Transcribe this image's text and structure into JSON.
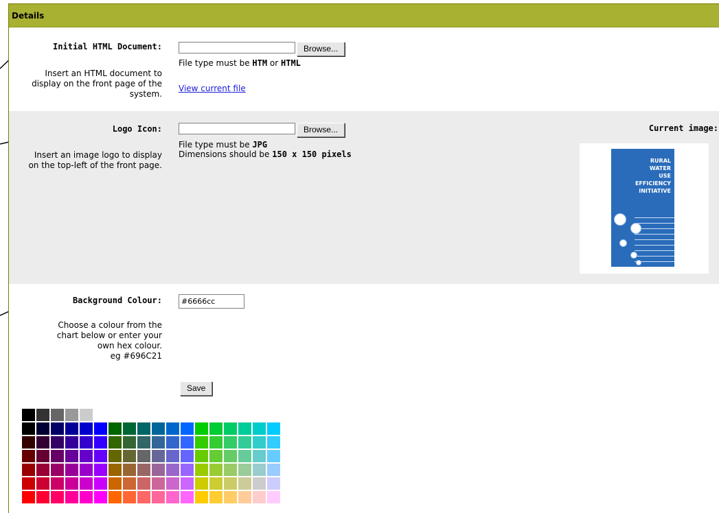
{
  "header": {
    "title": "Details"
  },
  "initial_html": {
    "label": "Initial HTML Document:",
    "description": "Insert an HTML document to display on the front page of the system.",
    "browse": "Browse...",
    "note_prefix": "File type must be ",
    "note_htm": "HTM",
    "note_or": " or ",
    "note_html": "HTML",
    "link": "View current file"
  },
  "logo_icon": {
    "label": "Logo Icon:",
    "description": "Insert an image logo to display on the top-left of the front page.",
    "browse": "Browse...",
    "note1_prefix": "File type must be ",
    "note1_type": "JPG",
    "note2_prefix": "Dimensions should be ",
    "note2_dims": "150 x 150 pixels",
    "current_label": "Current image:",
    "logo_lines": [
      "RURAL",
      "WATER",
      "USE",
      "EFFICIENCY",
      "INITIATIVE"
    ]
  },
  "background": {
    "label": "Background Colour:",
    "description_lines": [
      "Choose a colour from the",
      "chart below or enter your",
      "own hex colour.",
      "eg #696C21"
    ],
    "value": "#6666cc",
    "save": "Save"
  },
  "palette": {
    "greys": [
      "#000000",
      "#333333",
      "#666666",
      "#999999",
      "#cccccc"
    ],
    "rows": [
      [
        "#000000",
        "#000033",
        "#000066",
        "#000099",
        "#0000cc",
        "#0000ff",
        "#006600",
        "#006633",
        "#006666",
        "#006699",
        "#0066cc",
        "#0066ff",
        "#00cc00",
        "#00cc33",
        "#00cc66",
        "#00cc99",
        "#00cccc",
        "#00ccff"
      ],
      [
        "#330000",
        "#330033",
        "#330066",
        "#330099",
        "#3300cc",
        "#3300ff",
        "#336600",
        "#336633",
        "#336666",
        "#336699",
        "#3366cc",
        "#3366ff",
        "#33cc00",
        "#33cc33",
        "#33cc66",
        "#33cc99",
        "#33cccc",
        "#33ccff"
      ],
      [
        "#660000",
        "#660033",
        "#660066",
        "#660099",
        "#6600cc",
        "#6600ff",
        "#666600",
        "#666633",
        "#666666",
        "#666699",
        "#6666cc",
        "#6666ff",
        "#66cc00",
        "#66cc33",
        "#66cc66",
        "#66cc99",
        "#66cccc",
        "#66ccff"
      ],
      [
        "#990000",
        "#990033",
        "#990066",
        "#990099",
        "#9900cc",
        "#9900ff",
        "#996600",
        "#996633",
        "#996666",
        "#996699",
        "#9966cc",
        "#9966ff",
        "#99cc00",
        "#99cc33",
        "#99cc66",
        "#99cc99",
        "#99cccc",
        "#99ccff"
      ],
      [
        "#cc0000",
        "#cc0033",
        "#cc0066",
        "#cc0099",
        "#cc00cc",
        "#cc00ff",
        "#cc6600",
        "#cc6633",
        "#cc6666",
        "#cc6699",
        "#cc66cc",
        "#cc66ff",
        "#cccc00",
        "#cccc33",
        "#cccc66",
        "#cccc99",
        "#cccccc",
        "#ccccff"
      ],
      [
        "#ff0000",
        "#ff0033",
        "#ff0066",
        "#ff0099",
        "#ff00cc",
        "#ff00ff",
        "#ff6600",
        "#ff6633",
        "#ff6666",
        "#ff6699",
        "#ff66cc",
        "#ff66ff",
        "#ffcc00",
        "#ffcc33",
        "#ffcc66",
        "#ffcc99",
        "#ffcccc",
        "#ffccff"
      ]
    ]
  },
  "colors": {
    "header": "#a9b133",
    "grey_section": "#ececec",
    "link": "#1a1adb",
    "logo_blue": "#2a6cba"
  }
}
